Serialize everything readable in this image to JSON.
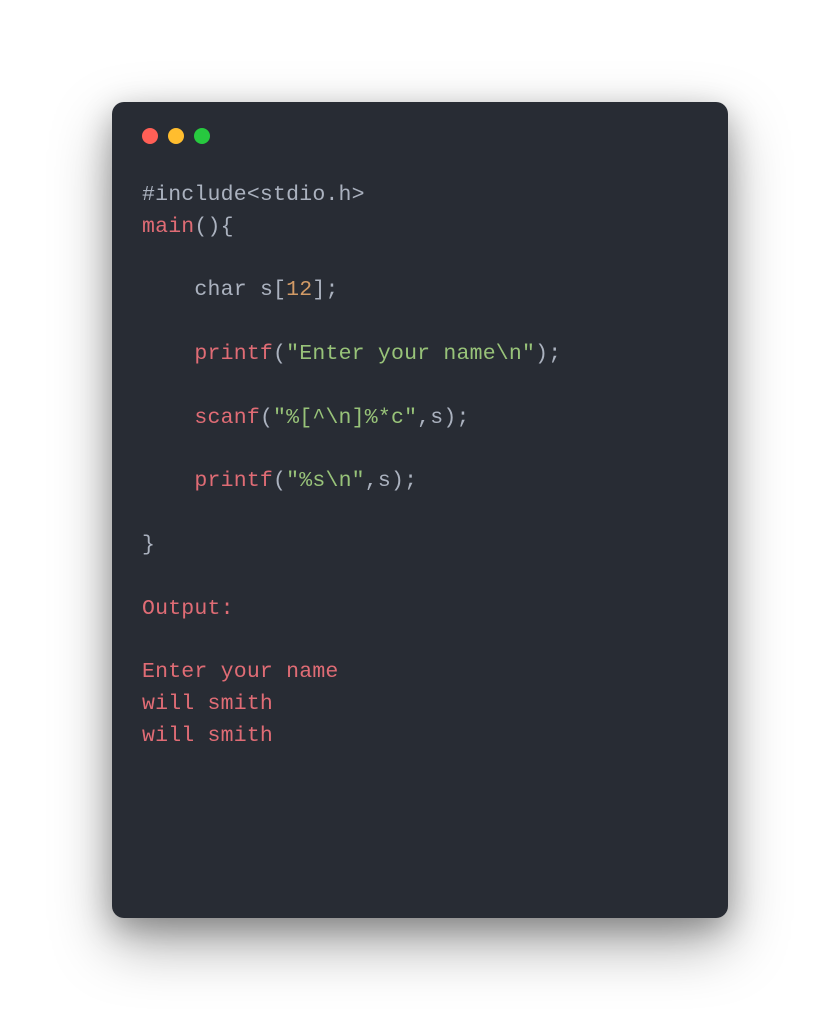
{
  "code": {
    "l1_include": "#include<stdio.h>",
    "l2_main": "main",
    "l2_rest": "(){",
    "l4_indent": "    ",
    "l4_char": "char",
    "l4_space": " s[",
    "l4_num": "12",
    "l4_end": "];",
    "l6_indent": "    ",
    "l6_printf": "printf",
    "l6_open": "(",
    "l6_str": "\"Enter your name\\n\"",
    "l6_close": ");",
    "l8_indent": "    ",
    "l8_scanf": "scanf",
    "l8_open": "(",
    "l8_str": "\"%[^\\n]%*c\"",
    "l8_mid": ",s",
    "l8_close": ");",
    "l10_indent": "    ",
    "l10_printf": "printf",
    "l10_open": "(",
    "l10_str": "\"%s\\n\"",
    "l10_mid": ",s",
    "l10_close": ");",
    "l12_brace": "}",
    "l14_output": "Output:",
    "l16_out1": "Enter your name",
    "l17_out2": "will smith",
    "l18_out3": "will smith"
  }
}
